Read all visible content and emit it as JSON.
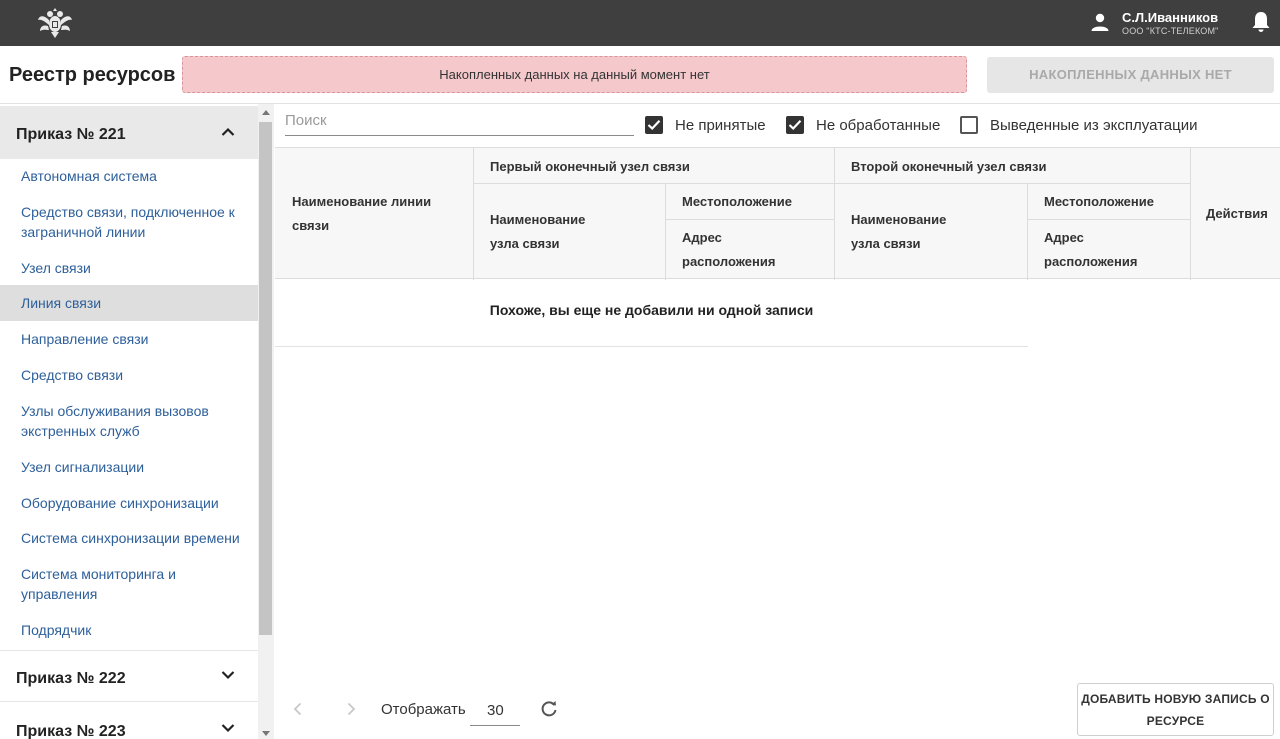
{
  "user": {
    "name": "С.Л.Иванников",
    "org": "ООО \"КТС-ТЕЛЕКОМ\""
  },
  "page": {
    "title": "Реестр ресурсов",
    "notice": "Накопленных данных на данный момент нет",
    "accum_button": "НАКОПЛЕННЫХ ДАННЫХ НЕТ"
  },
  "sidebar": {
    "sections": [
      {
        "title": "Приказ № 221",
        "expanded": true
      },
      {
        "title": "Приказ № 222",
        "expanded": false
      },
      {
        "title": "Приказ № 223",
        "expanded": false
      }
    ],
    "items": [
      {
        "label": "Автономная система"
      },
      {
        "label": "Средство связи, подключенное к заграничной линии"
      },
      {
        "label": "Узел связи"
      },
      {
        "label": "Линия связи",
        "selected": true
      },
      {
        "label": "Направление связи"
      },
      {
        "label": "Средство связи"
      },
      {
        "label": "Узлы обслуживания вызовов экстренных служб"
      },
      {
        "label": "Узел сигнализации"
      },
      {
        "label": "Оборудование синхронизации"
      },
      {
        "label": "Система синхронизации времени"
      },
      {
        "label": "Система мониторинга и управления"
      },
      {
        "label": "Подрядчик"
      }
    ]
  },
  "filters": {
    "search_placeholder": "Поиск",
    "not_accepted": {
      "label": "Не принятые",
      "checked": true
    },
    "not_processed": {
      "label": "Не обработанные",
      "checked": true
    },
    "decommissioned": {
      "label": "Выведенные из эксплуатации",
      "checked": false
    }
  },
  "table": {
    "col_line_name": "Наименование линии связи",
    "group_first": "Первый оконечный узел связи",
    "group_second": "Второй оконечный узел связи",
    "node_name": "Наименование узла связи",
    "location": "Местоположение",
    "address": "Адрес расположения",
    "actions": "Действия",
    "empty_message": "Похоже, вы еще не добавили ни одной записи"
  },
  "footer": {
    "display_label": "Отображать",
    "page_size": "30",
    "add_button": "ДОБАВИТЬ НОВУЮ ЗАПИСЬ О РЕСУРСЕ"
  },
  "colors": {
    "topbar": "#3f3f3f",
    "link": "#2d5f9a",
    "notice_bg": "#f5c9cc"
  },
  "icons": [
    "emblem-icon",
    "user-icon",
    "bell-icon",
    "chevron-up-icon",
    "chevron-down-icon",
    "check-icon",
    "chevron-left-icon",
    "chevron-right-icon",
    "refresh-icon"
  ]
}
